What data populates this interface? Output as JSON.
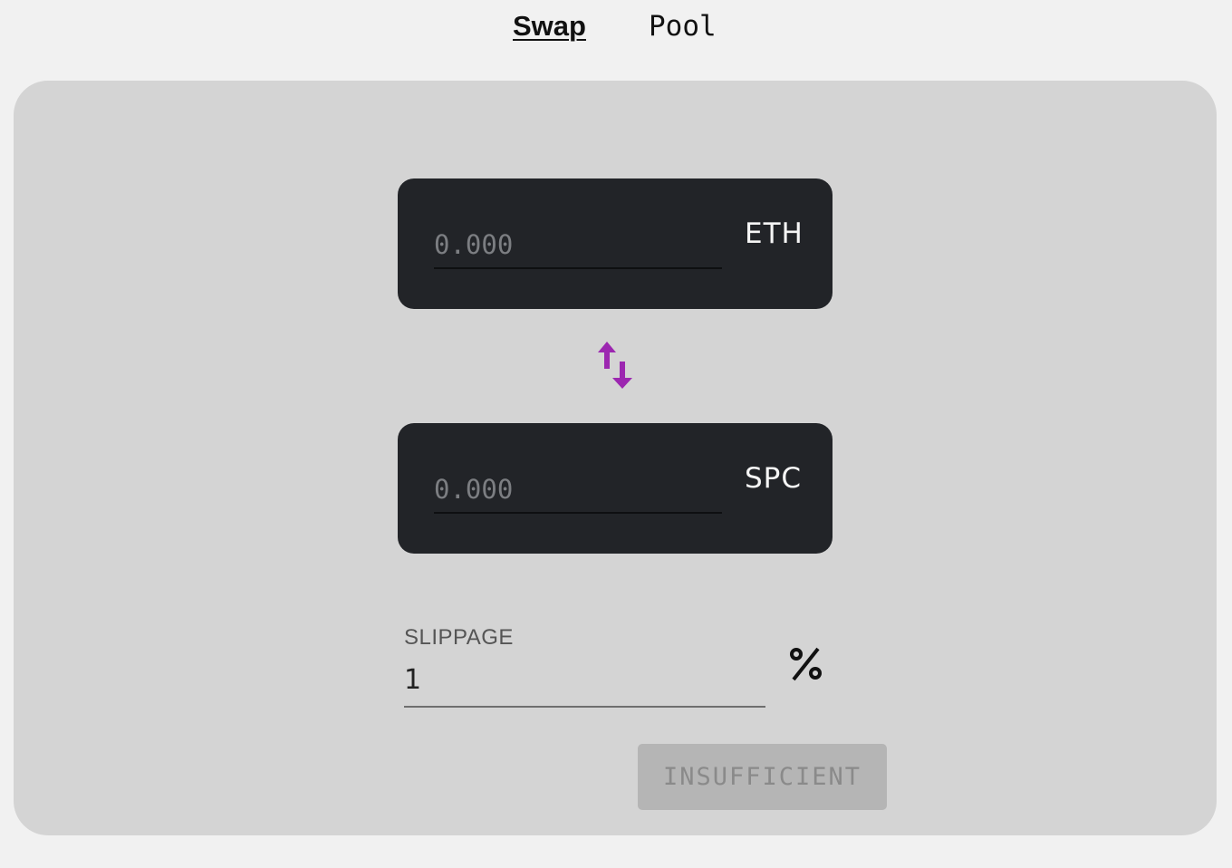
{
  "nav": {
    "tabs": [
      {
        "label": "Swap",
        "active": true
      },
      {
        "label": "Pool",
        "active": false
      }
    ]
  },
  "swap": {
    "from": {
      "placeholder": "0.000",
      "value": "",
      "token": "ETH"
    },
    "to": {
      "placeholder": "0.000",
      "value": "",
      "token": "SPC"
    },
    "switch_icon": "swap-vertical-arrows-icon",
    "slippage": {
      "label": "SLIPPAGE",
      "value": "1",
      "unit_icon": "percent-icon"
    },
    "submit": {
      "label": "INSUFFICIENT",
      "disabled": true
    }
  },
  "colors": {
    "page_bg": "#f1f1f1",
    "panel_bg": "#d4d4d4",
    "token_box_bg": "#222428",
    "accent_purple": "#9c27b0",
    "disabled_button_bg": "#b5b5b5"
  }
}
